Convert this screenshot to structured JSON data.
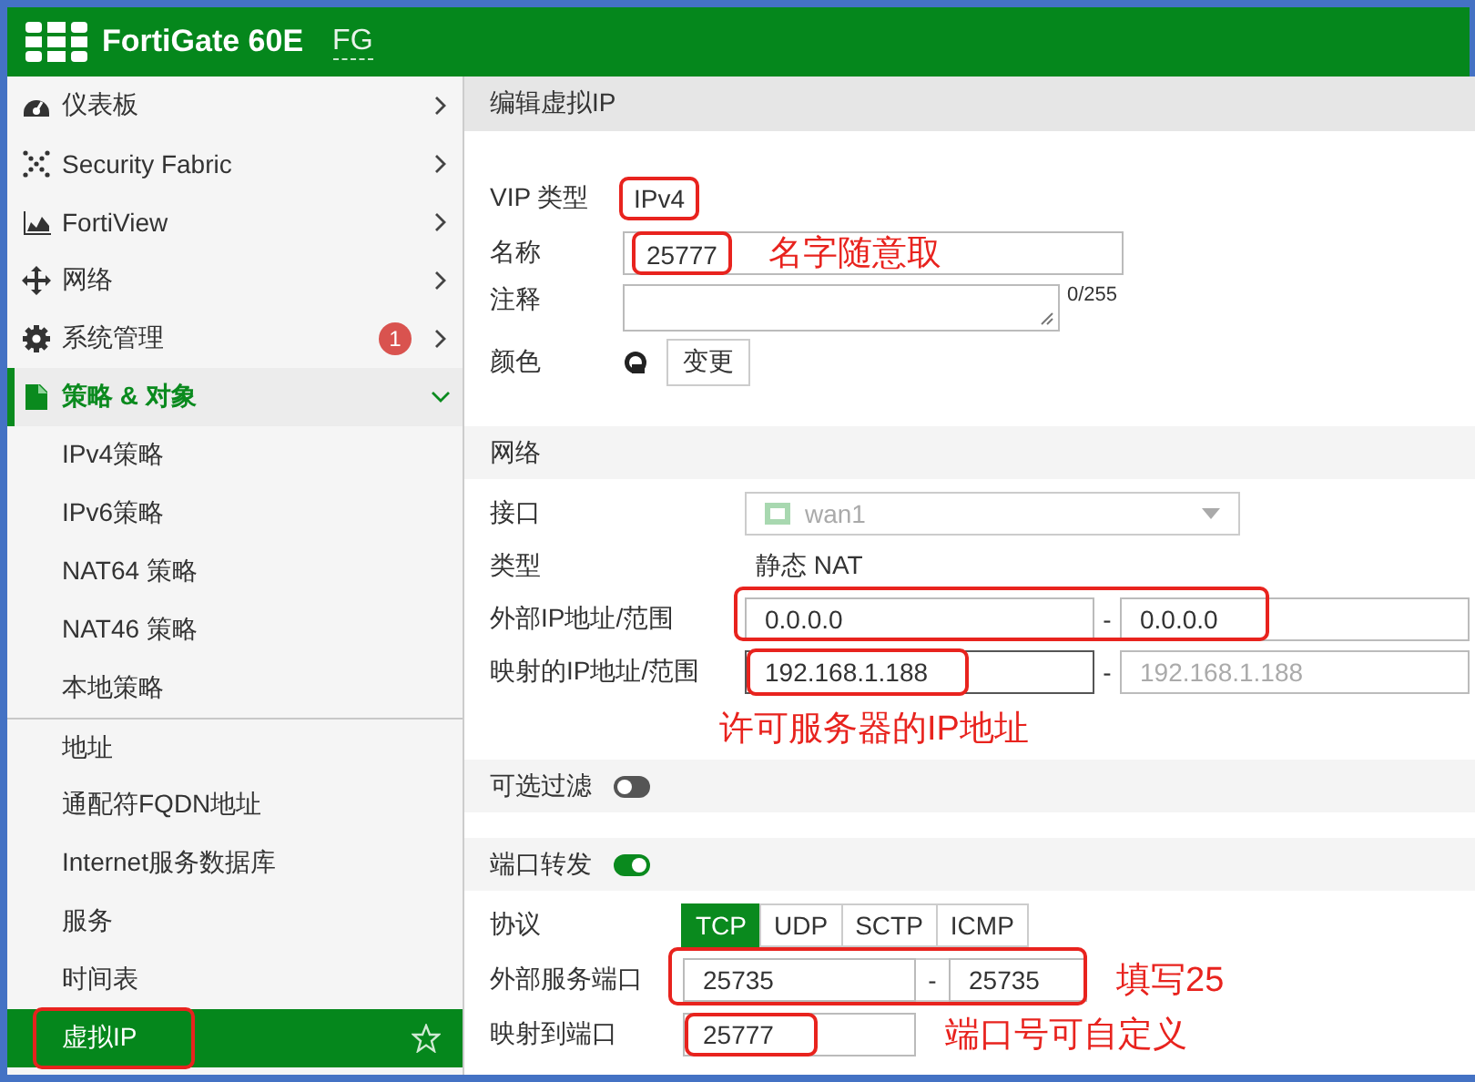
{
  "header": {
    "product": "FortiGate 60E",
    "hostname": "FG"
  },
  "sidebar": {
    "items": [
      {
        "kind": "dashboard",
        "label": "仪表板",
        "expanded": false,
        "active": false
      },
      {
        "kind": "fabric",
        "label": "Security Fabric",
        "expanded": false,
        "active": false
      },
      {
        "kind": "chart",
        "label": "FortiView",
        "expanded": false,
        "active": false
      },
      {
        "kind": "move",
        "label": "网络",
        "expanded": false,
        "active": false
      },
      {
        "kind": "gear",
        "label": "系统管理",
        "badge": "1",
        "expanded": false,
        "active": false
      },
      {
        "kind": "policy",
        "label": "策略 & 对象",
        "expanded": true,
        "active": true,
        "children": [
          {
            "label": "IPv4策略",
            "selected": false,
            "divider_before": false,
            "highlighted": false
          },
          {
            "label": "IPv6策略",
            "selected": false,
            "divider_before": false,
            "highlighted": false
          },
          {
            "label": "NAT64 策略",
            "selected": false,
            "divider_before": false,
            "highlighted": false
          },
          {
            "label": "NAT46 策略",
            "selected": false,
            "divider_before": false,
            "highlighted": false
          },
          {
            "label": "本地策略",
            "selected": false,
            "divider_before": false,
            "highlighted": false
          },
          {
            "label": "地址",
            "selected": false,
            "divider_before": true,
            "highlighted": false
          },
          {
            "label": "通配符FQDN地址",
            "selected": false,
            "divider_before": false,
            "highlighted": false
          },
          {
            "label": "Internet服务数据库",
            "selected": false,
            "divider_before": false,
            "highlighted": false
          },
          {
            "label": "服务",
            "selected": false,
            "divider_before": false,
            "highlighted": false
          },
          {
            "label": "时间表",
            "selected": false,
            "divider_before": false,
            "highlighted": false
          },
          {
            "label": "虚拟IP",
            "selected": true,
            "divider_before": false,
            "highlighted": true
          }
        ]
      }
    ]
  },
  "form": {
    "title": "编辑虚拟IP",
    "general": {
      "vip_type": {
        "label": "VIP 类型",
        "value": "IPv4",
        "highlighted": true
      },
      "name": {
        "label": "名称",
        "value": "25777",
        "highlighted": true,
        "note": "名字随意取"
      },
      "comment": {
        "label": "注释",
        "counter": "0/255"
      },
      "color": {
        "label": "颜色",
        "button": "变更"
      }
    },
    "network": {
      "title": "网络",
      "interface": {
        "label": "接口",
        "value": "wan1",
        "disabled": true
      },
      "type": {
        "label": "类型",
        "value": "静态 NAT"
      },
      "external_ip": {
        "label": "外部IP地址/范围",
        "from": "0.0.0.0",
        "separator": "-",
        "to": "0.0.0.0",
        "highlighted": true
      },
      "mapped_ip": {
        "label": "映射的IP地址/范围",
        "from": "192.168.1.188",
        "separator": "-",
        "placeholder": "192.168.1.188",
        "highlighted": true
      },
      "note": "许可服务器的IP地址"
    },
    "optional_filter": {
      "label": "可选过滤",
      "on": false
    },
    "port_forwarding": {
      "label": "端口转发",
      "on": true,
      "protocol_label": "协议",
      "protocols": [
        {
          "label": "TCP",
          "selected": true
        },
        {
          "label": "UDP",
          "selected": false
        },
        {
          "label": "SCTP",
          "selected": false
        },
        {
          "label": "ICMP",
          "selected": false
        }
      ],
      "external_port": {
        "label": "外部服务端口",
        "from": "25735",
        "separator": "-",
        "to": "25735",
        "highlighted": true,
        "note": "填写25"
      },
      "mapped_port": {
        "label": "映射到端口",
        "from": "25777",
        "highlighted": true,
        "note": "端口号可自定义"
      }
    }
  }
}
